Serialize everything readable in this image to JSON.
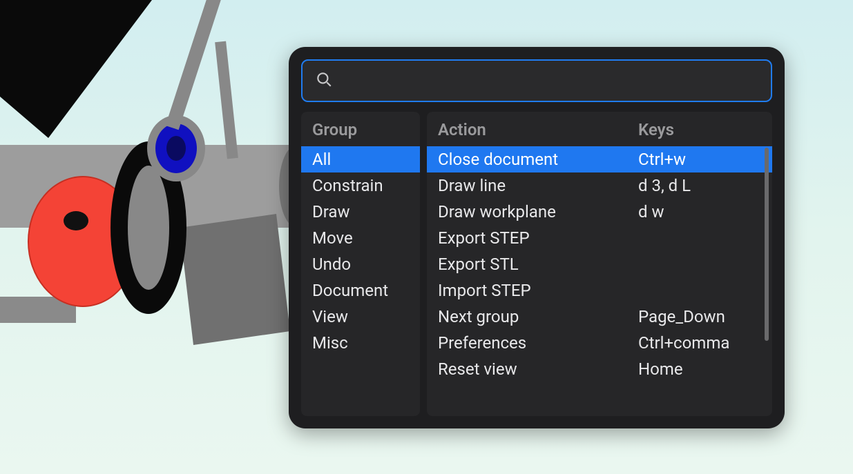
{
  "search": {
    "value": "",
    "placeholder": ""
  },
  "headers": {
    "group": "Group",
    "action": "Action",
    "keys": "Keys"
  },
  "groups": [
    {
      "label": "All",
      "selected": true
    },
    {
      "label": "Constrain",
      "selected": false
    },
    {
      "label": "Draw",
      "selected": false
    },
    {
      "label": "Move",
      "selected": false
    },
    {
      "label": "Undo",
      "selected": false
    },
    {
      "label": "Document",
      "selected": false
    },
    {
      "label": "View",
      "selected": false
    },
    {
      "label": "Misc",
      "selected": false
    }
  ],
  "actions": [
    {
      "label": "Close document",
      "keys": "Ctrl+w",
      "selected": true
    },
    {
      "label": "Draw line",
      "keys": "d 3, d L",
      "selected": false
    },
    {
      "label": "Draw workplane",
      "keys": "d w",
      "selected": false
    },
    {
      "label": "Export STEP",
      "keys": "",
      "selected": false
    },
    {
      "label": "Export STL",
      "keys": "",
      "selected": false
    },
    {
      "label": "Import STEP",
      "keys": "",
      "selected": false
    },
    {
      "label": "Next group",
      "keys": "Page_Down",
      "selected": false
    },
    {
      "label": "Preferences",
      "keys": "Ctrl+comma",
      "selected": false
    },
    {
      "label": "Reset view",
      "keys": "Home",
      "selected": false
    }
  ]
}
